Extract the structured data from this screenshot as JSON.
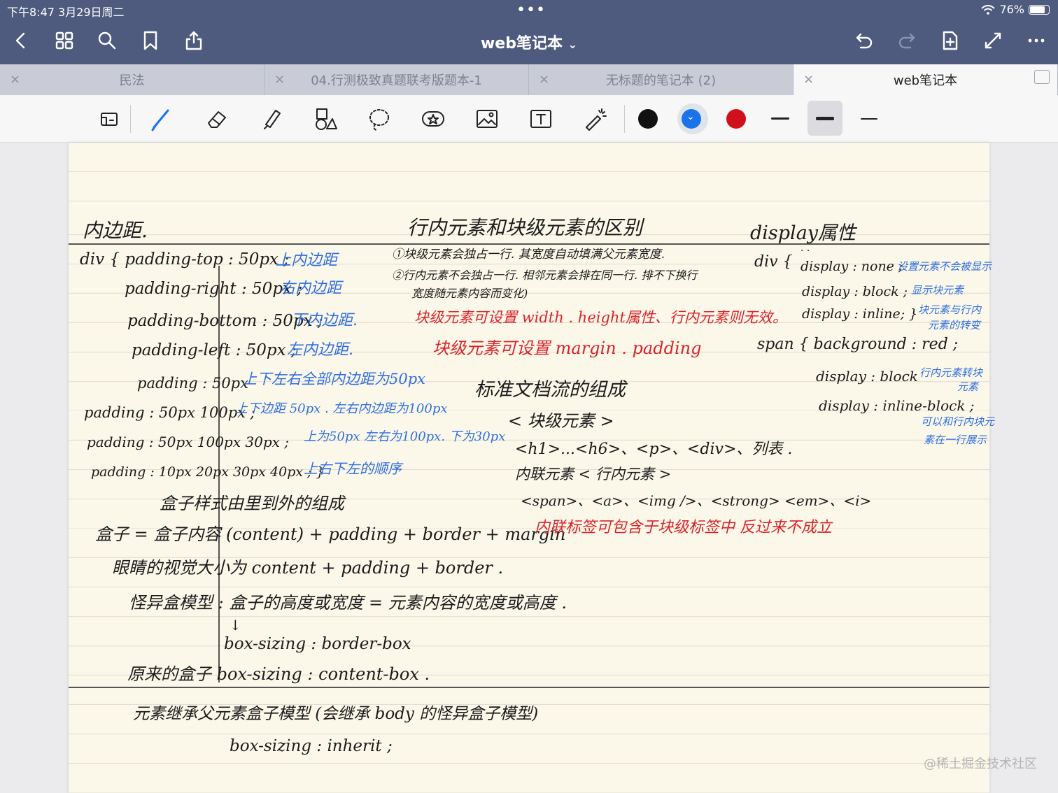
{
  "status_bar": {
    "time_date": "下午8:47   3月29日周二",
    "battery": "76%",
    "battery_level": 0.76
  },
  "nav": {
    "title": "web笔记本",
    "title_chevron": "⌄"
  },
  "tabs": [
    {
      "label": "民法",
      "active": false
    },
    {
      "label": "04.行测极致真题联考版题本-1",
      "active": false
    },
    {
      "label": "无标题的笔记本 (2)",
      "active": false
    },
    {
      "label": "web笔记本",
      "active": true
    }
  ],
  "tab_close": "×",
  "toolbar": {
    "colors": [
      "#111111",
      "#1a73e8",
      "#d0111b"
    ],
    "selected_color": "#1a73e8"
  },
  "notes": {
    "col1": {
      "heading": "内边距.",
      "lines": [
        {
          "code": "div { padding-top : 50px ;",
          "note": "上内边距"
        },
        {
          "code": "padding-right : 50px ;",
          "note": "右内边距"
        },
        {
          "code": "padding-bottom : 50px ;",
          "note": "下内边距."
        },
        {
          "code": "padding-left : 50px ;",
          "note": "左内边距."
        },
        {
          "code": "padding : 50px",
          "note": "上下左右全部内边距为50px"
        },
        {
          "code": "padding : 50px 100px ;",
          "note": "上下边距 50px . 左右内边距为100px"
        },
        {
          "code": "padding : 50px 100px 30px ;",
          "note": "上为50px 左右为100px. 下为30px"
        },
        {
          "code": "padding : 10px 20px 30px 40px ; }",
          "note": "上右下左的顺序"
        }
      ],
      "box_heading": "盒子样式由里到外的组成",
      "box_formula": "盒子 = 盒子内容 (content) + padding + border + margin",
      "eye_formula": "眼睛的视觉大小为  content + padding + border .",
      "weird_model": "怪异盒模型 : 盒子的高度或宽度 = 元素内容的宽度或高度 .",
      "arrow": "↓",
      "boxsizing_border": "box-sizing : border-box",
      "orig_box": "原来的盒子 box-sizing : content-box .",
      "inherit_title": "元素继承父元素盒子模型 (会继承 body 的怪异盒子模型)",
      "inherit_code": "box-sizing : inherit ;"
    },
    "col2": {
      "heading": "行内元素和块级元素的区别",
      "p1": "①块级元素会独占一行. 其宽度自动填满父元素宽度.",
      "p2": "②行内元素不会独占一行. 相邻元素会排在同一行. 排不下换行",
      "p2b": "宽度随元素内容而变化)",
      "red1": "块级元素可设置 width . height属性、行内元素则无效。",
      "red2": "块级元素可设置 margin . padding",
      "standard": "标准文档流的组成",
      "block_tag": "< 块级元素 >",
      "block_list": "<h1>...<h6>、<p>、<div>、列表 .",
      "inline_tag": "内联元素 < 行内元素 >",
      "inline_list": "<span>、<a>、<img />、<strong> <em>、<i>",
      "red3": "内联标签可包含于块级标签中 反过来不成立"
    },
    "col3": {
      "heading": "display属性",
      "dots": "· ·",
      "div_open": "div {",
      "d1": "display : none ;",
      "d1n": "设置元素不会被显示",
      "d2": "display : block ;",
      "d2n": "显示块元素",
      "d3": "display : inline; }",
      "d3n1": "块元素与行内",
      "d3n2": "元素的转变",
      "span_open": "span {  background : red ;",
      "d4": "display : block",
      "d4n1": "行内元素转块",
      "d4n2": "元素",
      "d5": "display : inline-block ;",
      "d5n1": "可以和行内块元",
      "d5n2": "素在一行展示"
    }
  },
  "watermark": "@稀土掘金技术社区"
}
